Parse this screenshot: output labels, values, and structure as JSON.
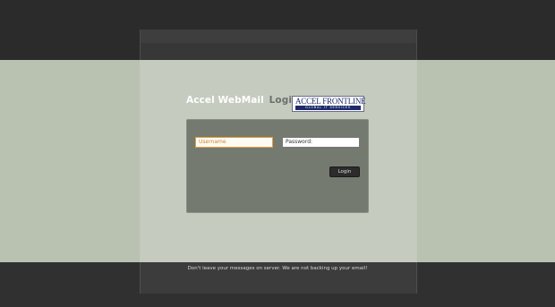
{
  "login": {
    "title_main": "Accel WebMail",
    "title_sub": "Login",
    "logo_brand": "ACCEL FRONTLINE",
    "logo_tagline": "GLOBAL IT SERVICES",
    "username_value": "Username",
    "password_value": "Password:",
    "login_button": "Login"
  },
  "footer": {
    "message": "Don't leave your messages on server. We are not backing up your email!"
  },
  "colors": {
    "background_band": "#b9c1b1",
    "panel": "#757a71",
    "focus_border": "#e0a03c",
    "brand_blue": "#1d2a6a"
  }
}
